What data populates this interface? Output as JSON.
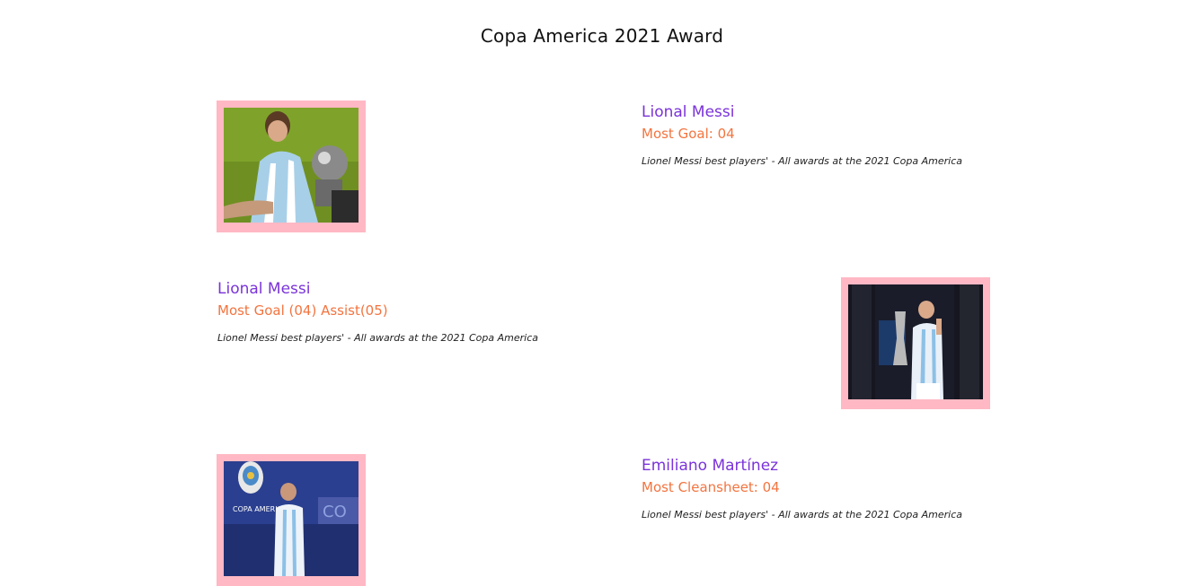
{
  "page": {
    "title": "Copa America 2021 Award"
  },
  "colors": {
    "name": "#7a33d9",
    "award": "#f3743f",
    "frame": "#ffb8c4"
  },
  "awards": [
    {
      "player": "Lional Messi",
      "award": "Most Goal: 04",
      "description": "Lionel Messi best players' - All awards at the 2021 Copa America",
      "image": "messi-with-golden-boot-photo"
    },
    {
      "player": "Lional Messi",
      "award": "Most Goal (04) Assist(05)",
      "description": "Lionel Messi best players' - All awards at the 2021 Copa America",
      "image": "messi-with-best-player-trophy-photo"
    },
    {
      "player": "Emiliano Martínez",
      "award": "Most Cleansheet: 04",
      "description": "Lionel Messi best players' - All awards at the 2021 Copa America",
      "image": "martinez-at-podium-photo"
    }
  ]
}
